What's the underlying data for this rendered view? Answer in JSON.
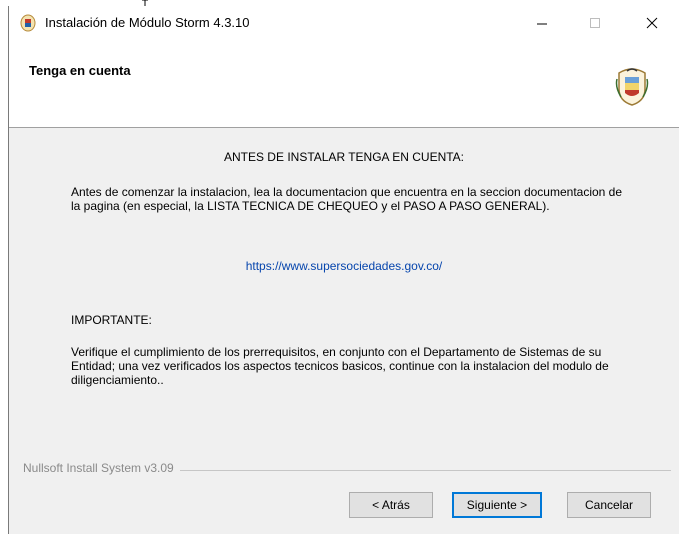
{
  "window": {
    "title": "Instalación de Módulo Storm 4.3.10",
    "controls": {
      "minimize": "—",
      "maximize": "☐",
      "close": "✕"
    }
  },
  "header": {
    "title": "Tenga en cuenta",
    "logo_icon": "colombia-coat-of-arms-icon"
  },
  "content": {
    "heading": "ANTES DE INSTALAR TENGA EN CUENTA:",
    "paragraph1": "Antes de comenzar la instalacion, lea la documentacion que encuentra en la seccion documentacion de la pagina (en especial, la LISTA TECNICA DE CHEQUEO y el PASO A PASO GENERAL).",
    "link": "https://www.supersociedades.gov.co/",
    "important_label": "IMPORTANTE:",
    "paragraph2": "Verifique el cumplimiento de los prerrequisitos, en conjunto con el Departamento de Sistemas de su Entidad; una vez verificados los aspectos tecnicos basicos, continue con la instalacion del modulo de diligenciamiento.."
  },
  "footer": {
    "brand": "Nullsoft Install System v3.09",
    "back_label": "< Atrás",
    "next_label": "Siguiente >",
    "cancel_label": "Cancelar"
  },
  "colors": {
    "link": "#0645ad",
    "focus_border": "#0078d7",
    "window_bg": "#f0f0f0"
  }
}
